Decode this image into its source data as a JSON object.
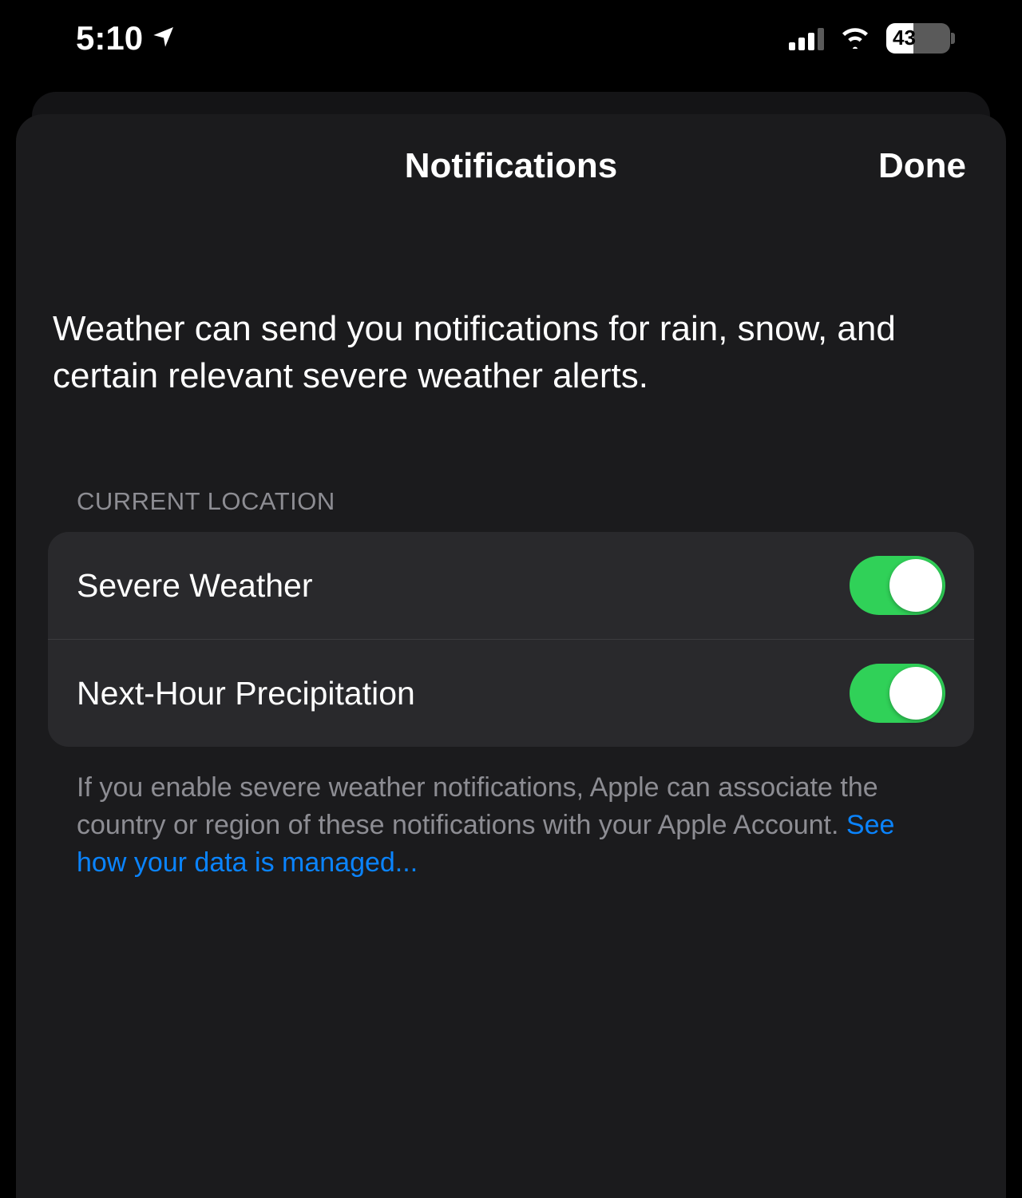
{
  "status_bar": {
    "time": "5:10",
    "battery_percent": "43"
  },
  "modal": {
    "title": "Notifications",
    "done_label": "Done"
  },
  "intro_text": "Weather can send you notifications for rain, snow, and certain relevant severe weather alerts.",
  "section": {
    "header": "CURRENT LOCATION",
    "items": [
      {
        "label": "Severe Weather",
        "enabled": true
      },
      {
        "label": "Next-Hour Precipitation",
        "enabled": true
      }
    ]
  },
  "footer": {
    "text": "If you enable severe weather notifications, Apple can associate the country or region of these notifications with your Apple Account. ",
    "link_text": "See how your data is managed..."
  },
  "colors": {
    "toggle_on": "#30d158",
    "link": "#0a84ff",
    "bg_sheet": "#1b1b1d",
    "bg_card": "#29292c",
    "text_secondary": "#8d8d93"
  }
}
